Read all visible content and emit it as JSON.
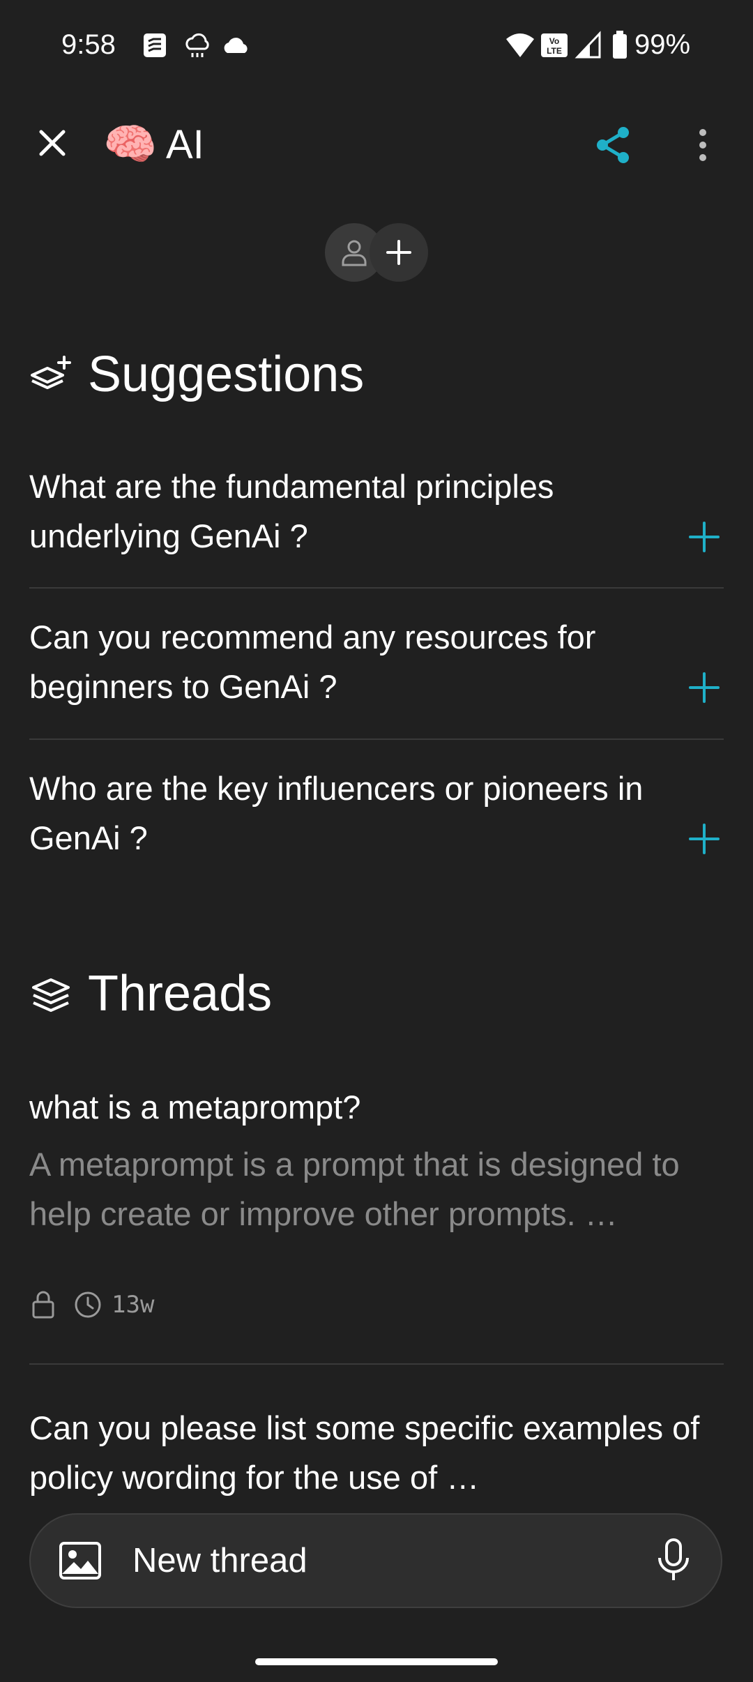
{
  "status_bar": {
    "time": "9:58",
    "battery_text": "99%",
    "icons": [
      "notification-app-icon",
      "weather-icon",
      "cloud-icon",
      "wifi-icon",
      "volte-icon",
      "signal-icon",
      "battery-icon"
    ]
  },
  "app_bar": {
    "emoji": "🧠",
    "title": "AI",
    "accent_color": "#1fb0c8"
  },
  "suggestions": {
    "heading": "Suggestions",
    "items": [
      {
        "label": "What are the fundamental principles underlying GenAi ?"
      },
      {
        "label": "Can you recommend any resources for beginners to GenAi ?"
      },
      {
        "label": "Who are the key influencers or pioneers in GenAi ?"
      }
    ]
  },
  "threads": {
    "heading": "Threads",
    "items": [
      {
        "title": "what is a metaprompt?",
        "preview": "A metaprompt is a prompt that is designed to help create or improve other prompts. …",
        "age": "13w"
      },
      {
        "title": "Can you please list some specific examples of policy wording for the use of …"
      }
    ]
  },
  "composer": {
    "placeholder": "New thread"
  }
}
